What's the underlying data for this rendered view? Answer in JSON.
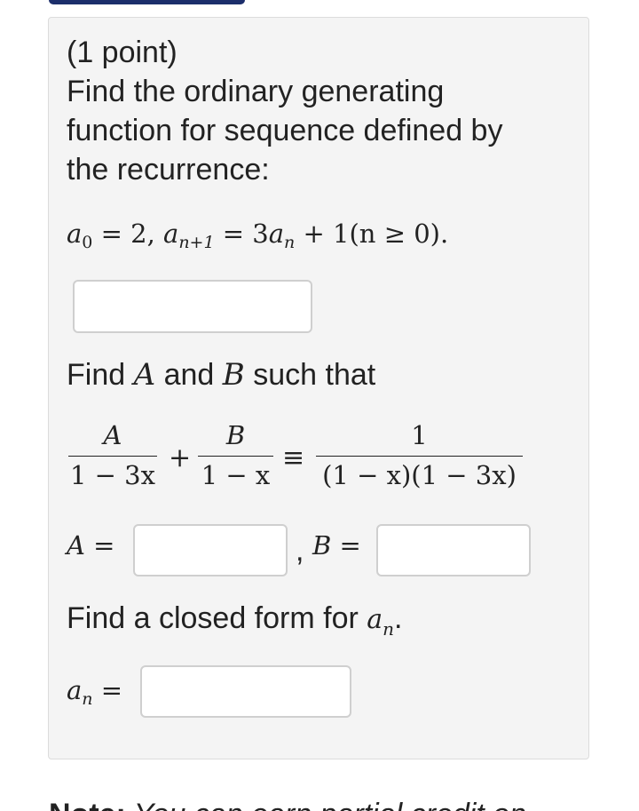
{
  "problem": {
    "points": "(1 point)",
    "line1": "Find the ordinary generating",
    "line2": "function for sequence defined by",
    "line3": "the recurrence:",
    "recurrence": {
      "a": "a",
      "sub0": "0",
      "eq1": " = 2, ",
      "sub_n1": "n+1",
      "eq2": " = 3",
      "sub_n": "n",
      "tail": " + 1(n ≥ 0)."
    },
    "find_ab_prefix": "Find ",
    "var_a": "A",
    "find_ab_mid": " and ",
    "var_b": "B",
    "find_ab_suffix": " such that",
    "fractions": {
      "f1_num": "A",
      "f1_den": "1 − 3x",
      "plus": "+",
      "f2_num": "B",
      "f2_den": "1 − x",
      "equiv": "≡",
      "f3_num": "1",
      "f3_den": "(1 − x)(1 − 3x)"
    },
    "a_label": "A =",
    "b_sep": ",",
    "b_label": "B =",
    "closed_form_prefix": "Find a closed form for ",
    "closed_form_var": "a",
    "closed_form_sub": "n",
    "closed_form_suffix": ".",
    "an_label_var": "a",
    "an_label_sub": "n",
    "an_label_eq": " ="
  },
  "inputs": {
    "gf_value": "",
    "a_value": "",
    "b_value": "",
    "an_value": ""
  },
  "note": {
    "bold": "Note:",
    "text": " You can earn partial credit on"
  }
}
